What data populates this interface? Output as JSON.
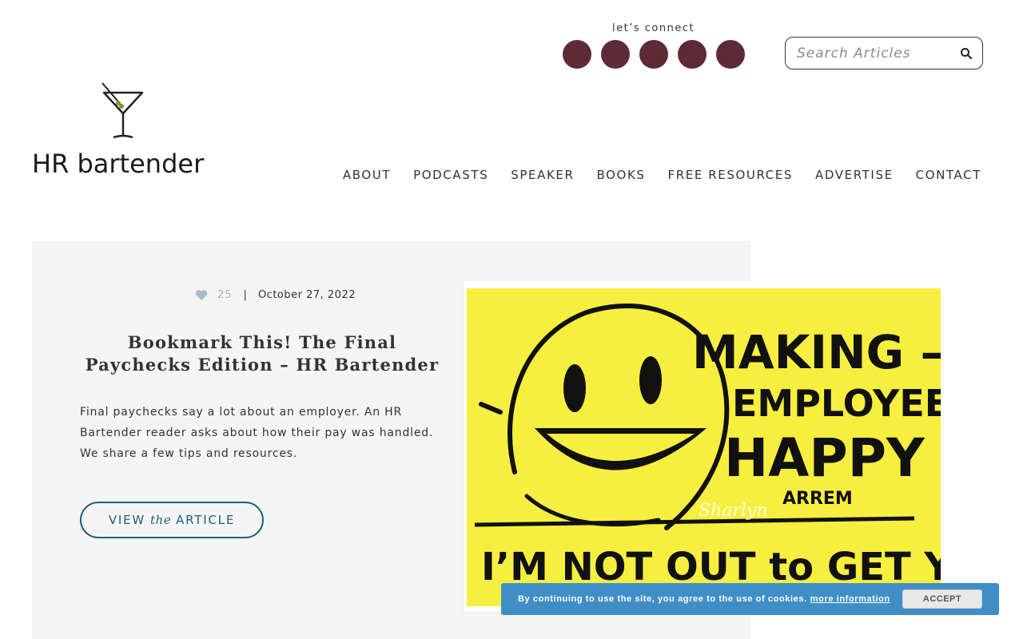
{
  "header": {
    "connect_label": "let’s connect",
    "social_icons": [
      "social-icon-1",
      "social-icon-2",
      "social-icon-3",
      "social-icon-4",
      "social-icon-5"
    ],
    "search_placeholder": "Search Articles",
    "logo_text": "HR bartender"
  },
  "nav": {
    "items": [
      "ABOUT",
      "PODCASTS",
      "SPEAKER",
      "BOOKS",
      "FREE RESOURCES",
      "ADVERTISE",
      "CONTACT"
    ]
  },
  "feature": {
    "likes": "25",
    "separator": "|",
    "date": "October 27, 2022",
    "title": "Bookmark This! The Final Paychecks Edition – HR Bartender",
    "excerpt": "Final paychecks say a lot about an employer. An HR Bartender reader asks about how their pay was handled. We share a few tips and resources.",
    "cta_view": "VIEW",
    "cta_the": "the",
    "cta_article": "ARTICLE",
    "image_text": {
      "line1": "MAKING —",
      "line2": "EMPLOYEES",
      "line3": "HAPPY",
      "line4": "ARREM",
      "line5": "I’M NOT OUT to GET YOU!",
      "signature": "Sharlyn"
    }
  },
  "cookie": {
    "message": "By continuing to use the site, you agree to the use of cookies.",
    "more_info": "more information",
    "accept": "ACCEPT"
  },
  "colors": {
    "social_dot": "#5e2a35",
    "cta": "#1f5f7a",
    "card_bg": "#f5f5f5",
    "cookie_bg": "#3f8ec6",
    "image_yellow": "#f7ef3f"
  }
}
